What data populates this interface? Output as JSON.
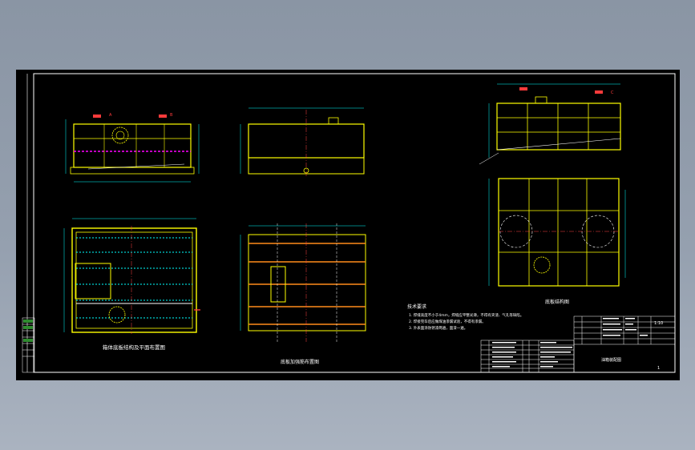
{
  "colors": {
    "background": "#8d98a8",
    "drawing_area": "#000000",
    "frame": "#ffffff",
    "outline": "#ffff00",
    "section_lines": "#ff00ff",
    "hatch": "#ff8c1a",
    "dimensions": "#00ffff",
    "dashed_red": "#ff3b3b",
    "centerline": "#ff4040",
    "annotation": "#ffffff"
  },
  "labels": {
    "view_bottom_left": "箱体底板结构及平面布置图",
    "view_bottom_middle": "底板加强筋布置图",
    "view_right": "底板结构图",
    "notes_title": "技术要求",
    "note_1": "1. 焊缝高度不小于4mm，焊缝应平整光滑，不得有夹渣、气孔等缺陷。",
    "note_2": "2. 焊接完毕后应做煤油渗漏试验，不得有渗漏。",
    "note_3": "3. 外表面涂防锈漆两遍，面漆一遍。",
    "title_block_name": "油箱装配图",
    "scale": "1:10",
    "sheet": "1",
    "tag_a": "A",
    "tag_b": "B",
    "tag_c": "C"
  }
}
